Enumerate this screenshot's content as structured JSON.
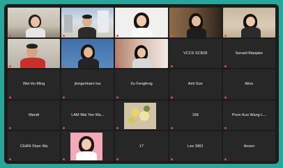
{
  "tiles": [
    {
      "type": "video",
      "scene": "office",
      "label": ""
    },
    {
      "type": "video",
      "scene": "buildings",
      "label": ""
    },
    {
      "type": "video",
      "scene": "white",
      "label": ""
    },
    {
      "type": "video",
      "scene": "window",
      "label": ""
    },
    {
      "type": "video",
      "scene": "room",
      "label": ""
    },
    {
      "type": "video",
      "scene": "man-red",
      "label": ""
    },
    {
      "type": "video",
      "scene": "blue",
      "label": ""
    },
    {
      "type": "video",
      "scene": "curtain",
      "label": ""
    },
    {
      "type": "name",
      "name": "VCCS SCB28",
      "label": ""
    },
    {
      "type": "name",
      "name": "Senaid Manjake",
      "label": ""
    },
    {
      "type": "name",
      "name": "Wei Hu Ming",
      "label": ""
    },
    {
      "type": "name",
      "name": "jlongerlearn luo",
      "label": ""
    },
    {
      "type": "name",
      "name": "Xu Fengfeng",
      "label": ""
    },
    {
      "type": "name",
      "name": "Ami Sun",
      "label": ""
    },
    {
      "type": "name",
      "name": "Alice",
      "label": ""
    },
    {
      "type": "name",
      "name": "Mandi",
      "label": ""
    },
    {
      "type": "name",
      "name": "LAM Wai Yee Wa...",
      "label": ""
    },
    {
      "type": "image",
      "scene": "flowers",
      "label": ""
    },
    {
      "type": "name",
      "name": "158",
      "label": ""
    },
    {
      "type": "name",
      "name": "Poon Kuo Wang L...",
      "label": ""
    },
    {
      "type": "name",
      "name": "CHAN Shan Wa",
      "label": ""
    },
    {
      "type": "image",
      "scene": "portrait",
      "label": ""
    },
    {
      "type": "name",
      "name": "17",
      "label": ""
    },
    {
      "type": "name",
      "name": "Lee SBO",
      "label": ""
    },
    {
      "type": "name",
      "name": "Anson",
      "label": ""
    }
  ],
  "colors": {
    "background": "#2aa59a",
    "tile": "#272727",
    "frame": "#1c1c1c",
    "active_border": "#7fd17c"
  }
}
